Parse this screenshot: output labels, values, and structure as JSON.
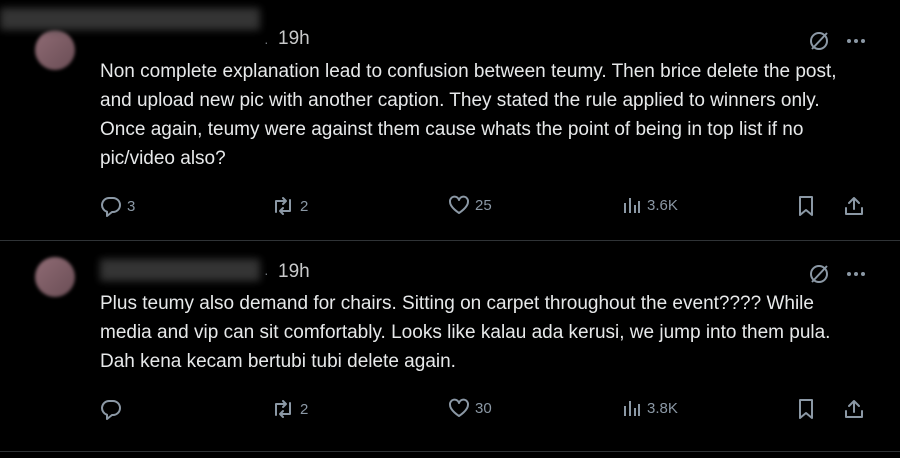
{
  "posts": [
    {
      "time": "19h",
      "text": "Non complete explanation lead to confusion between teumy. Then brice delete the post, and upload new pic with another caption. They stated the rule applied to winners only. Once again, teumy were against them cause whats the point of being in top list if no pic/video also?",
      "replies": "3",
      "reposts": "2",
      "likes": "25",
      "views": "3.6K"
    },
    {
      "time": "19h",
      "text": "Plus teumy also demand for chairs. Sitting on carpet throughout the event???? While media and vip can sit comfortably. Looks like kalau ada kerusi, we jump into them pula. Dah kena kecam bertubi tubi delete again.",
      "replies": "",
      "reposts": "2",
      "likes": "30",
      "views": "3.8K"
    }
  ],
  "icons": {
    "reply": "reply-icon",
    "repost": "repost-icon",
    "like": "like-icon",
    "views": "views-icon",
    "bookmark": "bookmark-icon",
    "share": "share-icon",
    "grok": "grok-icon",
    "more": "more-icon"
  }
}
